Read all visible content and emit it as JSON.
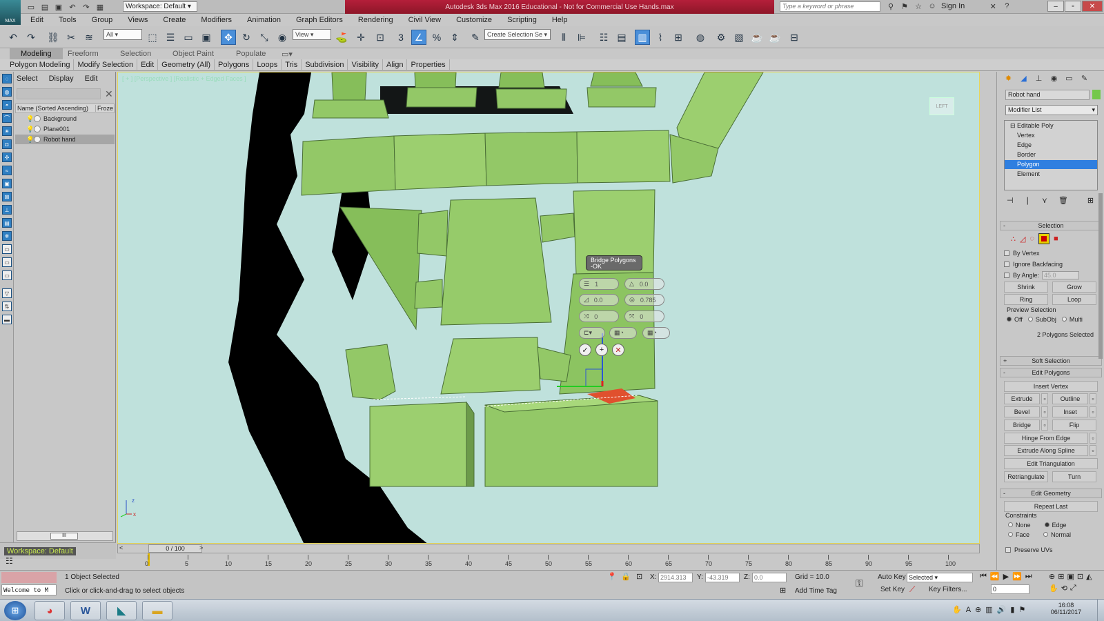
{
  "titlebar": {
    "title": "Autodesk 3ds Max 2016 Educational - Not for Commercial Use   Hands.max",
    "logo_text": "MAX",
    "workspace": "Workspace: Default",
    "search_placeholder": "Type a keyword or phrase",
    "sign_in": "Sign In"
  },
  "menu": [
    "Edit",
    "Tools",
    "Group",
    "Views",
    "Create",
    "Modifiers",
    "Animation",
    "Graph Editors",
    "Rendering",
    "Civil View",
    "Customize",
    "Scripting",
    "Help"
  ],
  "toolbar": {
    "filter": "All",
    "ref_coord": "View",
    "snap_label": "3",
    "selection_set": "Create Selection Se"
  },
  "ribbon": {
    "tabs": [
      "Modeling",
      "Freeform",
      "Selection",
      "Object Paint",
      "Populate"
    ],
    "active_tab": "Modeling",
    "subtabs": [
      "Polygon Modeling",
      "Modify Selection",
      "Edit",
      "Geometry (All)",
      "Polygons",
      "Loops",
      "Tris",
      "Subdivision",
      "Visibility",
      "Align",
      "Properties"
    ]
  },
  "scene_explorer": {
    "tabs": [
      "Select",
      "Display",
      "Edit"
    ],
    "col_name": "Name (Sorted Ascending)",
    "col_frozen": "Froze",
    "items": [
      {
        "name": "Background",
        "selected": false
      },
      {
        "name": "Plane001",
        "selected": false
      },
      {
        "name": "Robot hand",
        "selected": true
      }
    ],
    "scroll_grip": "III",
    "workspace": "Workspace: Default"
  },
  "viewport": {
    "label": "[ + ] [Perspective ] [Realistic + Edged Faces ]",
    "viewcube": "LEFT",
    "axis_x": "x",
    "axis_z": "z"
  },
  "caddy": {
    "title": "Bridge Polygons",
    "subtitle": "-OK",
    "segments": "1",
    "taper": "0.0",
    "bias": "0.0",
    "smooth": "0.785",
    "twist1": "0",
    "twist2": "0"
  },
  "timeline": {
    "position": "0 / 100",
    "ticks": [
      "0",
      "5",
      "10",
      "15",
      "20",
      "25",
      "30",
      "35",
      "40",
      "45",
      "50",
      "55",
      "60",
      "65",
      "70",
      "75",
      "80",
      "85",
      "90",
      "95",
      "100"
    ]
  },
  "status": {
    "maxscript": "Welcome to M",
    "selected": "1 Object Selected",
    "prompt": "Click or click-and-drag to select objects",
    "x_label": "X:",
    "x": "2914.313",
    "y_label": "Y:",
    "y": "-43.319",
    "z_label": "Z:",
    "z": "0.0",
    "grid": "Grid = 10.0",
    "add_time_tag": "Add Time Tag",
    "auto_key": "Auto Key",
    "set_key": "Set Key",
    "key_mode": "Selected",
    "key_filters": "Key Filters...",
    "frame": "0"
  },
  "taskbar": {
    "time": "16:08",
    "date": "06/11/2017"
  },
  "command_panel": {
    "object_name": "Robot hand",
    "modifier_list": "Modifier List",
    "stack": [
      "Editable Poly",
      "Vertex",
      "Edge",
      "Border",
      "Polygon",
      "Element"
    ],
    "stack_selected": "Polygon",
    "selection": {
      "title": "Selection",
      "by_vertex": "By Vertex",
      "ignore_backfacing": "Ignore Backfacing",
      "by_angle": "By Angle:",
      "angle": "45.0",
      "shrink": "Shrink",
      "grow": "Grow",
      "ring": "Ring",
      "loop": "Loop",
      "preview_title": "Preview Selection",
      "preview_off": "Off",
      "preview_subobj": "SubObj",
      "preview_multi": "Multi",
      "status": "2 Polygons Selected"
    },
    "soft_selection": "Soft Selection",
    "edit_polygons": {
      "title": "Edit Polygons",
      "insert_vertex": "Insert Vertex",
      "extrude": "Extrude",
      "outline": "Outline",
      "bevel": "Bevel",
      "inset": "Inset",
      "bridge": "Bridge",
      "flip": "Flip",
      "hinge": "Hinge From Edge",
      "extrude_spline": "Extrude Along Spline",
      "edit_triangulation": "Edit Triangulation",
      "retriangulate": "Retriangulate",
      "turn": "Turn"
    },
    "edit_geometry": {
      "title": "Edit Geometry",
      "repeat_last": "Repeat Last",
      "constraints": "Constraints",
      "none": "None",
      "edge": "Edge",
      "face": "Face",
      "normal": "Normal",
      "preserve_uvs": "Preserve UVs"
    }
  }
}
